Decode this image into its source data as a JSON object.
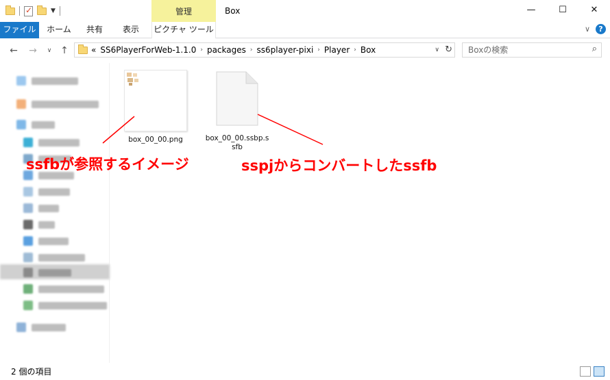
{
  "titlebar": {
    "manage_tab": "管理",
    "window_title": "Box",
    "controls": {
      "minimize": "—",
      "maximize": "☐",
      "close": "✕"
    }
  },
  "ribbon": {
    "tabs": [
      "ファイル",
      "ホーム",
      "共有",
      "表示",
      "ピクチャ ツール"
    ],
    "expand": "∨",
    "help": "?"
  },
  "nav": {
    "back": "←",
    "forward": "→",
    "recent": "∨",
    "up": "↑",
    "overflow": "«",
    "breadcrumbs": [
      "SS6PlayerForWeb-1.1.0",
      "packages",
      "ss6player-pixi",
      "Player",
      "Box"
    ],
    "separator": "›",
    "dropdown": "∨",
    "refresh": "↻"
  },
  "search": {
    "placeholder": "Boxの検索",
    "icon": "⌕"
  },
  "files": [
    {
      "name": "box_00_00.png",
      "kind": "image"
    },
    {
      "name_line1": "box_00_00.ssbp.s",
      "name_line2": "sfb",
      "kind": "document"
    }
  ],
  "annotations": {
    "left": "ssfbが参照するイメージ",
    "right": "sspjからコンバートしたssfb",
    "color": "#ff0000"
  },
  "status": {
    "count": "2 個の項目"
  },
  "colors": {
    "file_tab": "#1979ca",
    "manage_tab": "#f6f29c"
  }
}
